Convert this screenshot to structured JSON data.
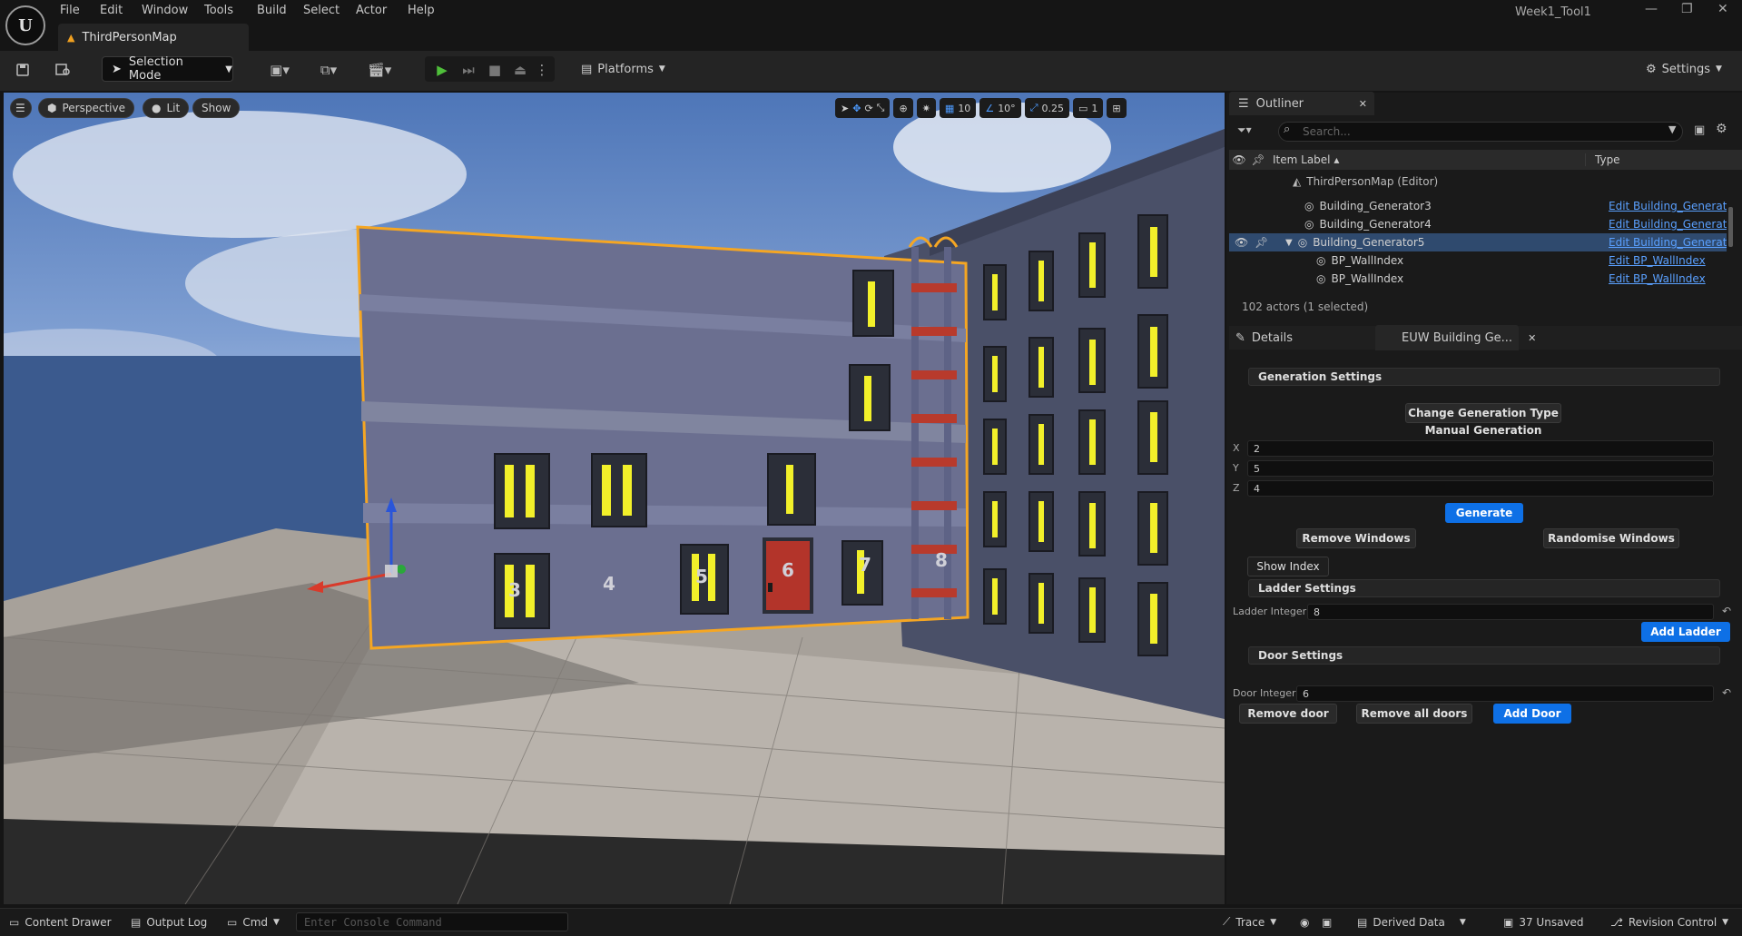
{
  "app": {
    "logo": "U",
    "menu": [
      "File",
      "Edit",
      "Window",
      "Tools",
      "Build",
      "Select",
      "Actor",
      "Help"
    ],
    "map_tab": "ThirdPersonMap",
    "window_title": "Week1_Tool1"
  },
  "toolbar": {
    "selection_mode": "Selection Mode",
    "platforms": "Platforms",
    "settings": "Settings"
  },
  "viewport": {
    "perspective": "Perspective",
    "lit": "Lit",
    "show": "Show",
    "grid_snap": "10",
    "rot_snap": "10°",
    "scale_snap": "0.25",
    "camera_speed": "1",
    "wall_index_labels": [
      "3",
      "4",
      "5",
      "6",
      "7",
      "8"
    ]
  },
  "outliner": {
    "tab": "Outliner",
    "search_placeholder": "Search...",
    "col_label": "Item Label ▴",
    "col_type": "Type",
    "root": "ThirdPersonMap (Editor)",
    "rows": [
      {
        "label": "Building_Generator3",
        "type": "Edit Building_Generator"
      },
      {
        "label": "Building_Generator4",
        "type": "Edit Building_Generator"
      },
      {
        "label": "Building_Generator5",
        "type": "Edit Building_Generator"
      },
      {
        "label": "BP_WallIndex",
        "type": "Edit BP_WallIndex"
      },
      {
        "label": "BP_WallIndex",
        "type": "Edit BP_WallIndex"
      }
    ],
    "actor_count": "102 actors (1 selected)"
  },
  "details": {
    "tab": "Details",
    "euw_tab": "EUW Building Ge...",
    "generation_settings": "Generation Settings",
    "change_generation_type": "Change Generation Type",
    "manual_generation": "Manual Generation",
    "x_label": "X",
    "x_value": "2",
    "y_label": "Y",
    "y_value": "5",
    "z_label": "Z",
    "z_value": "4",
    "generate": "Generate",
    "remove_windows": "Remove Windows",
    "randomise_windows": "Randomise Windows",
    "show_index": "Show Index",
    "ladder_settings": "Ladder Settings",
    "ladder_integer_label": "Ladder Integer",
    "ladder_integer_value": "8",
    "add_ladder": "Add Ladder",
    "door_settings": "Door Settings",
    "door_integer_label": "Door Integer",
    "door_integer_value": "6",
    "remove_door": "Remove door",
    "remove_all_doors": "Remove all doors",
    "add_door": "Add Door"
  },
  "statusbar": {
    "content_drawer": "Content Drawer",
    "output_log": "Output Log",
    "cmd": "Cmd",
    "console_placeholder": "Enter Console Command",
    "trace": "Trace",
    "derived_data": "Derived Data",
    "unsaved": "37 Unsaved",
    "revision_control": "Revision Control"
  }
}
